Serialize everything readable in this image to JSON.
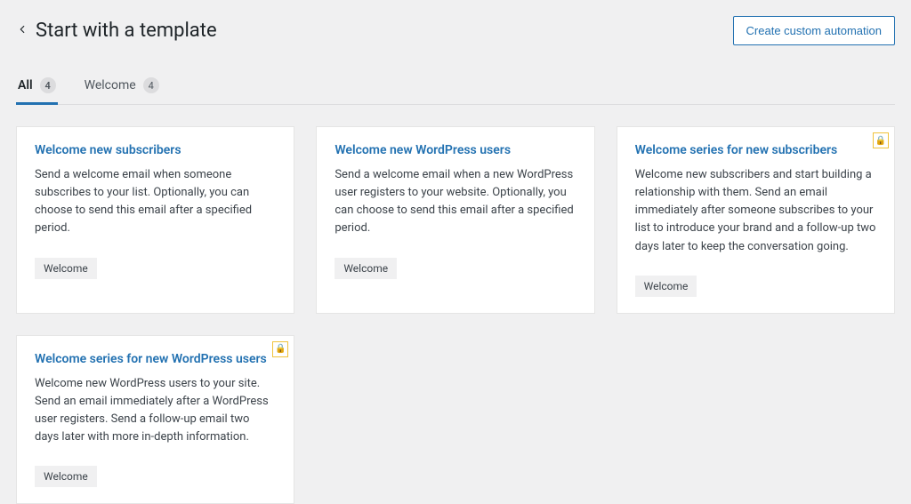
{
  "header": {
    "title": "Start with a template",
    "create_label": "Create custom automation"
  },
  "tabs": [
    {
      "label": "All",
      "count": "4",
      "active": true
    },
    {
      "label": "Welcome",
      "count": "4",
      "active": false
    }
  ],
  "cards": [
    {
      "title": "Welcome new subscribers",
      "description": "Send a welcome email when someone subscribes to your list. Optionally, you can choose to send this email after a specified period.",
      "tag": "Welcome",
      "locked": false
    },
    {
      "title": "Welcome new WordPress users",
      "description": "Send a welcome email when a new WordPress user registers to your website. Optionally, you can choose to send this email after a specified period.",
      "tag": "Welcome",
      "locked": false
    },
    {
      "title": "Welcome series for new subscribers",
      "description": "Welcome new subscribers and start building a relationship with them. Send an email immediately after someone subscribes to your list to introduce your brand and a follow-up two days later to keep the conversation going.",
      "tag": "Welcome",
      "locked": true
    },
    {
      "title": "Welcome series for new WordPress users",
      "description": "Welcome new WordPress users to your site. Send an email immediately after a WordPress user registers. Send a follow-up email two days later with more in-depth information.",
      "tag": "Welcome",
      "locked": true
    }
  ],
  "lock_glyph": "🔒"
}
